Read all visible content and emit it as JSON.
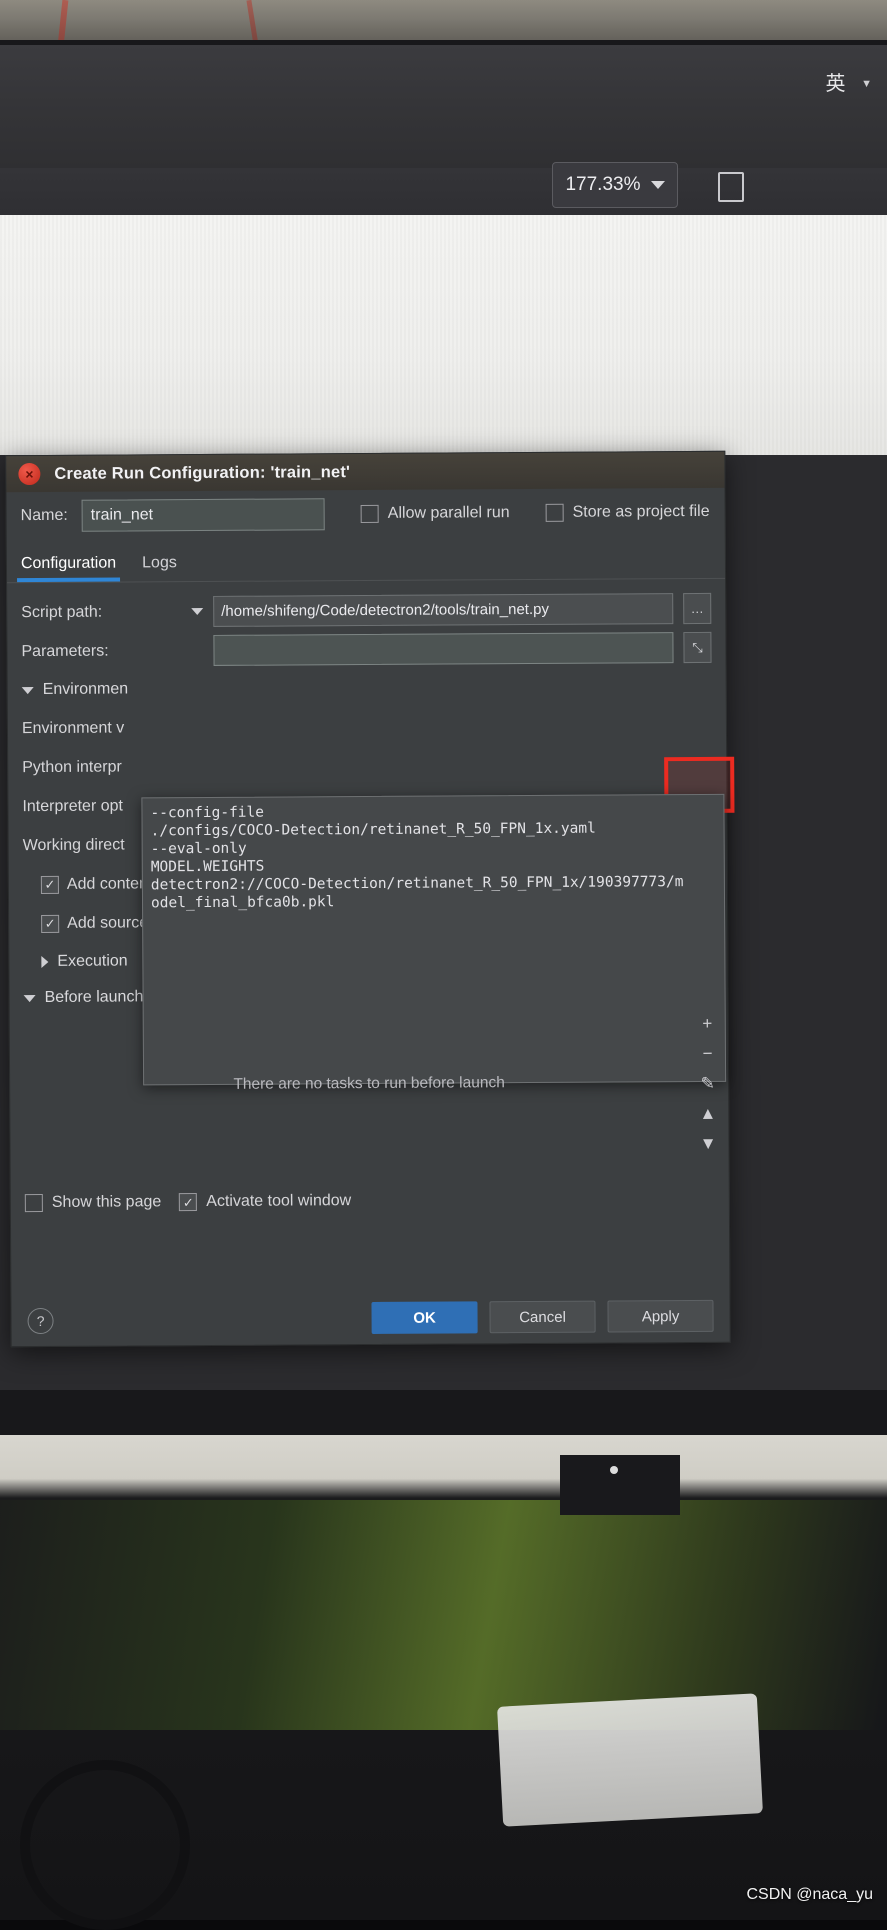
{
  "photo": {
    "watermark": "CSDN @naca_yu"
  },
  "app_topbar": {
    "ime_indicator": "英",
    "zoom_level": "177.33%"
  },
  "dialog": {
    "title": "Create Run Configuration: 'train_net'",
    "close_glyph": "×",
    "name_label": "Name:",
    "name_value": "train_net",
    "allow_parallel_run": {
      "label": "Allow parallel run",
      "checked": false
    },
    "store_as_project_file": {
      "label": "Store as project file",
      "checked": false
    },
    "tabs": [
      {
        "label": "Configuration",
        "active": true
      },
      {
        "label": "Logs",
        "active": false
      }
    ],
    "fields": {
      "script_path_label": "Script path:",
      "script_path_value": "/home/shifeng/Code/detectron2/tools/train_net.py",
      "parameters_label": "Parameters:",
      "parameters_value": "",
      "browse_glyph": "…",
      "expand_glyph": "⤡"
    },
    "left_labels": [
      "Environmen",
      "Environment v",
      "Python interpr",
      "Interpreter opt",
      "Working direct"
    ],
    "environment_section_label": "Environmen",
    "checkbox_rows": [
      {
        "label": "Add conten",
        "checked": true
      },
      {
        "label": "Add source",
        "checked": true
      }
    ],
    "execution_label": "Execution",
    "parameters_popup": {
      "lines": [
        "--config-file",
        "./configs/COCO-Detection/retinanet_R_50_FPN_1x.yaml",
        "--eval-only",
        "MODEL.WEIGHTS",
        "detectron2://COCO-Detection/retinanet_R_50_FPN_1x/190397773/m",
        "odel_final_bfca0b.pkl"
      ]
    },
    "before_launch": {
      "label": "Before launch",
      "empty_text": "There are no tasks to run before launch",
      "tools": [
        "+",
        "−",
        "✎",
        "▲",
        "▼"
      ]
    },
    "footer": {
      "show_this_page": {
        "label": "Show this page",
        "checked": false
      },
      "activate_tool_window": {
        "label": "Activate tool window",
        "checked": true
      },
      "help_glyph": "?"
    },
    "buttons": [
      {
        "label": "OK",
        "primary": true
      },
      {
        "label": "Cancel",
        "primary": false
      },
      {
        "label": "Apply",
        "primary": false
      }
    ]
  },
  "annotation": {
    "highlight_color": "#ec2b21"
  }
}
